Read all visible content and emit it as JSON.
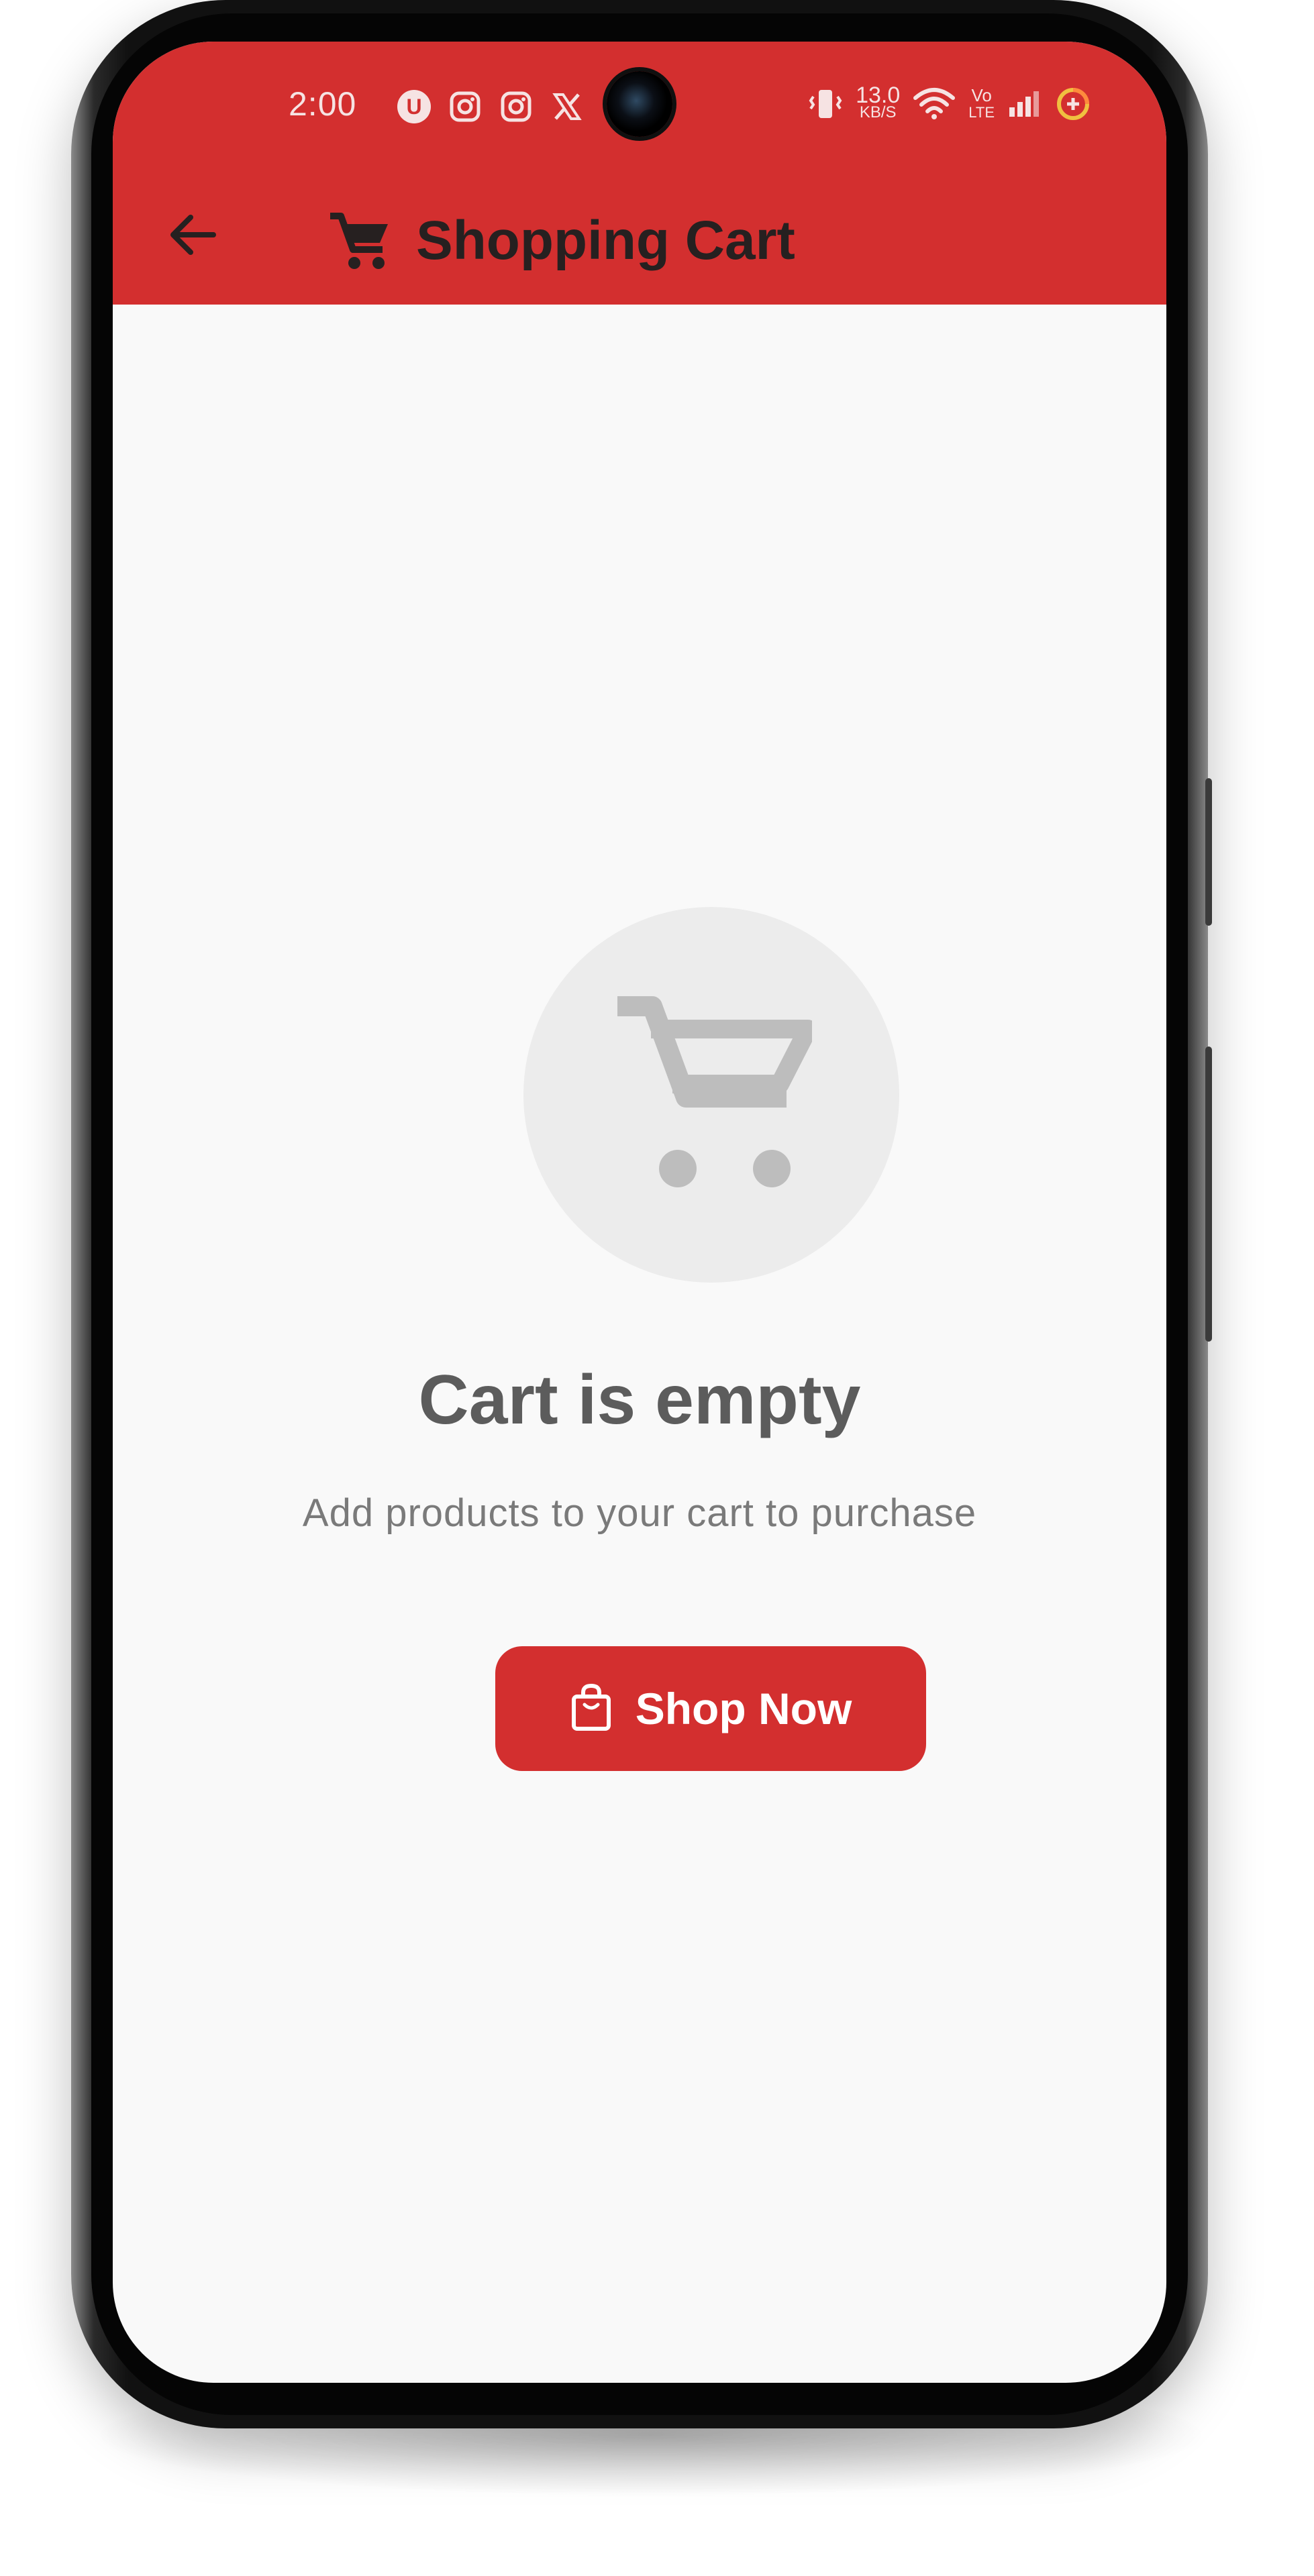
{
  "status_bar": {
    "time": "2:00",
    "network_speed_value": "13.0",
    "network_speed_unit": "KB/S",
    "volte_top": "Vo",
    "volte_bottom": "LTE",
    "left_icons": [
      "u-app-icon",
      "instagram-icon",
      "instagram-icon",
      "x-logo-icon"
    ],
    "right_icons": [
      "vibrate-icon",
      "wifi-icon",
      "signal-icon",
      "battery-saver-icon"
    ]
  },
  "app_bar": {
    "title": "Shopping Cart",
    "back_icon": "arrow-left-icon",
    "title_icon": "cart-icon",
    "background_color": "#d32f2f"
  },
  "empty_state": {
    "icon": "cart-icon",
    "title": "Cart is empty",
    "subtitle": "Add products to your cart to purchase"
  },
  "cta": {
    "label": "Shop Now",
    "icon": "shopping-bag-icon",
    "color": "#d32f2f"
  }
}
